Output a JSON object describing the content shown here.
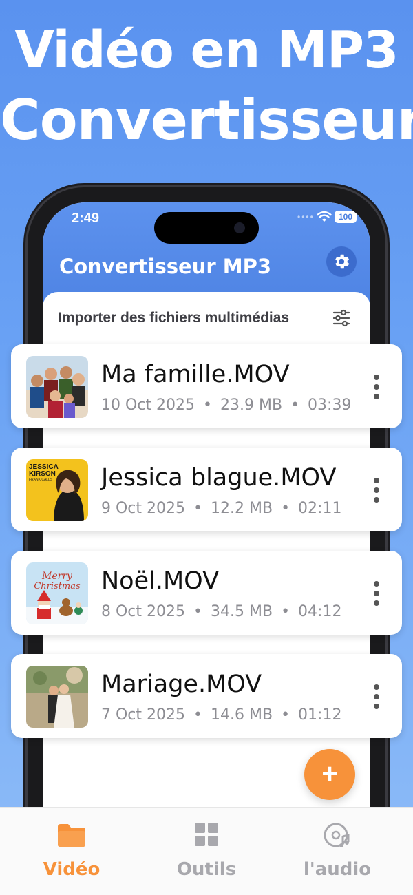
{
  "promo": {
    "line1": "Vidéo en MP3",
    "line2": "Convertisseur"
  },
  "status": {
    "time": "2:49",
    "battery": "100"
  },
  "app": {
    "title": "Convertisseur MP3",
    "import_label": "Importer des fichiers multimédias"
  },
  "files": [
    {
      "name": "Ma famille.MOV",
      "date": "10 Oct 2025",
      "size": "23.9 MB",
      "duration": "03:39",
      "thumb": "family-photo"
    },
    {
      "name": "Jessica blague.MOV",
      "date": "9 Oct 2025",
      "size": "12.2 MB",
      "duration": "02:11",
      "thumb": "jessica-kirson-cover",
      "thumb_text": [
        "JESSICA",
        "KIRSON",
        "FRANK CALLS"
      ]
    },
    {
      "name": "Noël.MOV",
      "date": "8 Oct 2025",
      "size": "34.5 MB",
      "duration": "04:12",
      "thumb": "christmas-card",
      "thumb_text": [
        "Merry",
        "Christmas"
      ]
    },
    {
      "name": "Mariage.MOV",
      "date": "7 Oct 2025",
      "size": "14.6 MB",
      "duration": "01:12",
      "thumb": "wedding-photo"
    }
  ],
  "meta_separator": "•",
  "fab": {
    "label": "+"
  },
  "tabs": [
    {
      "label": "Vidéo",
      "icon": "folder-icon",
      "active": true
    },
    {
      "label": "Outils",
      "icon": "grid-icon",
      "active": false
    },
    {
      "label": "l'audio",
      "icon": "music-disc-icon",
      "active": false
    }
  ],
  "colors": {
    "accent": "#f7923a",
    "header_blue": "#4a7fe0",
    "background_blue": "#6aa2f4"
  }
}
